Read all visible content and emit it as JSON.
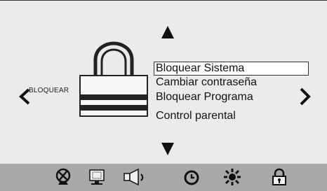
{
  "screen": {
    "side_label": "BLOQUEAR",
    "menu_items": [
      {
        "label": "Bloquear Sistema",
        "selected": true
      },
      {
        "label": "Cambiar contraseña",
        "selected": false
      },
      {
        "label": "Bloquear Programa",
        "selected": false
      },
      {
        "label": "Control parental",
        "selected": false
      }
    ]
  },
  "navigation": {
    "up": "up-arrow-icon",
    "down": "down-arrow-icon",
    "left": "chevron-left-icon",
    "right": "chevron-right-icon"
  },
  "bottom_bar": {
    "icons": [
      "satellite-dish-icon",
      "monitor-icon",
      "speaker-icon",
      "clock-icon",
      "settings-sun-icon",
      "padlock-icon"
    ],
    "colors": {
      "bar": "#a9a9a9",
      "icon": "#111111"
    }
  },
  "colors": {
    "background": "#ebebeb",
    "text": "#111111"
  }
}
